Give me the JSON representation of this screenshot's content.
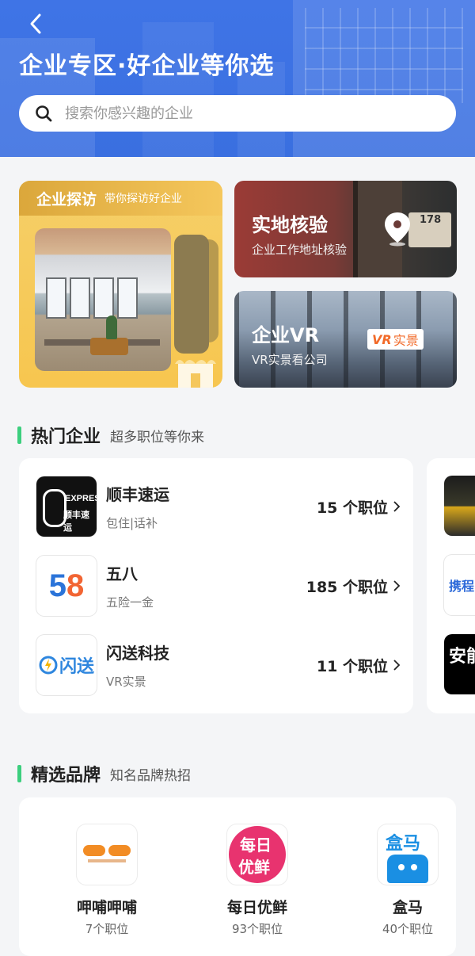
{
  "header": {
    "title": "企业专区·好企业等你选",
    "search_placeholder": "搜索你感兴趣的企业"
  },
  "features": {
    "visit": {
      "title": "企业探访",
      "subtitle": "带你探访好企业"
    },
    "verify": {
      "title": "实地核验",
      "subtitle": "企业工作地址核验",
      "door_number": "178"
    },
    "vr": {
      "title": "企业VR",
      "subtitle": "VR实景看公司",
      "badge_a": "VR",
      "badge_b": "实景"
    }
  },
  "hot": {
    "title": "热门企业",
    "subtitle": "超多职位等你来",
    "companies": [
      {
        "name": "顺丰速运",
        "tags": "包住|话补",
        "jobs": "15 个职位",
        "logo_text_1": "EXPRESS",
        "logo_text_2": "顺丰速运"
      },
      {
        "name": "五八",
        "tags": "五险一金",
        "jobs": "185 个职位",
        "logo_text_1": "5",
        "logo_text_2": "8"
      },
      {
        "name": "闪送科技",
        "tags": "VR实景",
        "jobs": "11 个职位",
        "logo_text_1": "闪送"
      }
    ],
    "peek": {
      "logo2_text": "携程",
      "logo3_text": "安能"
    }
  },
  "brands": {
    "title": "精选品牌",
    "subtitle": "知名品牌热招",
    "items": [
      {
        "name": "呷哺呷哺",
        "jobs": "7个职位"
      },
      {
        "name": "每日优鲜",
        "jobs": "93个职位",
        "logo_t1": "每日",
        "logo_t2": "优鲜"
      },
      {
        "name": "盒马",
        "jobs": "40个职位",
        "logo_t": "盒马"
      }
    ]
  },
  "colors": {
    "header_blue": "#3f74e6",
    "accent_green": "#3ccf7e",
    "visit_yellow": "#f7c64f"
  },
  "icons": {
    "back": "chevron-left-icon",
    "search": "search-icon",
    "pin": "location-pin-icon",
    "arrow": "chevron-right-icon"
  }
}
